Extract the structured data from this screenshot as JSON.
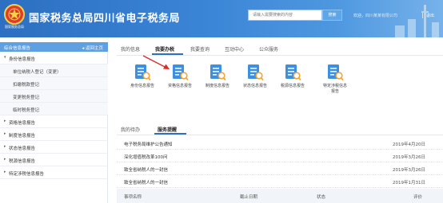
{
  "header": {
    "emblem_text": "国家税务总局",
    "title": "国家税务总局四川省电子税务局",
    "search_placeholder": "请输入需要搜索的内容",
    "search_button": "搜索",
    "welcome_prefix": "欢迎，",
    "welcome_name": "四川某某有限公司",
    "logout": "退出",
    "colors": {
      "header_start": "#2d6fc1",
      "header_end": "#76b2ea"
    }
  },
  "sidebar": {
    "title": "综合信息报告",
    "back_label": "返回主页",
    "groups": [
      {
        "label": "身份信息报告",
        "expanded": true,
        "children": [
          "单位纳税人登记（变更）",
          "扣缴税款登记",
          "变更税务登记",
          "临时税务登记"
        ]
      },
      {
        "label": "资格信息报告",
        "expanded": false
      },
      {
        "label": "制度信息报告",
        "expanded": false
      },
      {
        "label": "状态信息报告",
        "expanded": false
      },
      {
        "label": "税源信息报告",
        "expanded": false
      },
      {
        "label": "特定涉税信息报告",
        "expanded": false
      }
    ]
  },
  "tabs": [
    "我的信息",
    "我要办税",
    "我要查询",
    "互动中心",
    "公众服务"
  ],
  "active_tab": "我要办税",
  "tiles": [
    {
      "label": "身份信息报告",
      "icon": "document-search-icon"
    },
    {
      "label": "资格信息报告",
      "icon": "document-search-icon"
    },
    {
      "label": "制度信息报告",
      "icon": "document-search-icon"
    },
    {
      "label": "状态信息报告",
      "icon": "document-search-icon"
    },
    {
      "label": "税源信息报告",
      "icon": "document-search-icon"
    },
    {
      "label": "特定涉税信息报告",
      "icon": "document-search-icon"
    }
  ],
  "lower_tabs": [
    "我的待办",
    "服务提醒"
  ],
  "active_lower_tab": "服务提醒",
  "notices": [
    {
      "title": "电子税务局维护公告通知",
      "date": "2019年4月20日"
    },
    {
      "title": "深化增值税改革100问",
      "date": "2019年3月26日"
    },
    {
      "title": "致全省纳税人的一封信",
      "date": "2019年3月26日"
    },
    {
      "title": "致全省纳税人的一封信",
      "date": "2019年1月31日"
    }
  ],
  "table_headers": [
    "事项名称",
    "截止日期",
    "状态",
    "评价"
  ]
}
